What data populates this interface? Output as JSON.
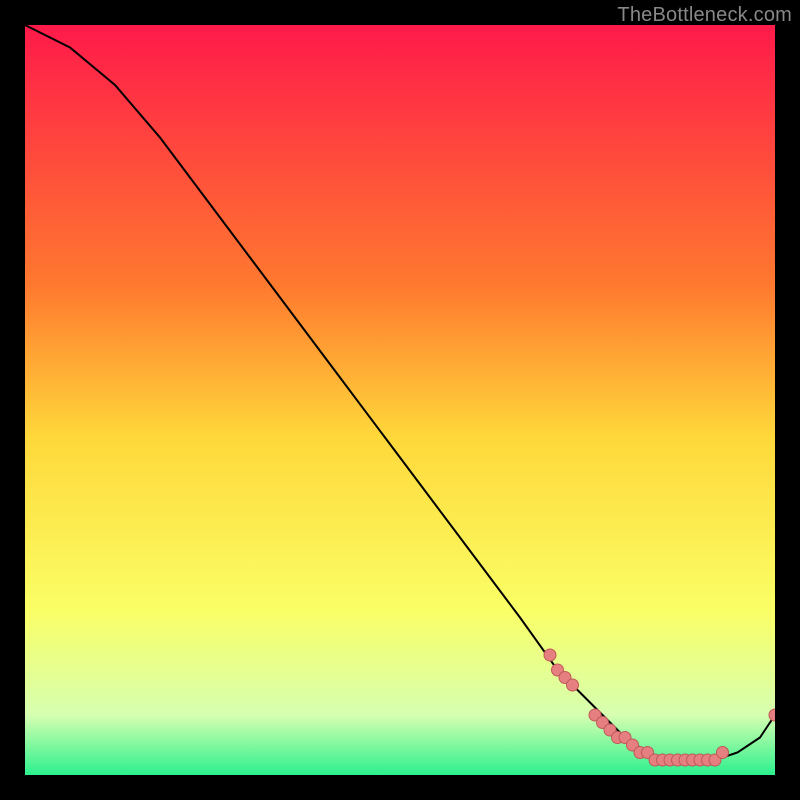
{
  "watermark": "TheBottleneck.com",
  "colors": {
    "background": "#000000",
    "gradient_top": "#ff1a4a",
    "gradient_mid_upper": "#ff7a2f",
    "gradient_mid": "#ffd83a",
    "gradient_mid_lower": "#faff66",
    "gradient_lower": "#d6ffb0",
    "gradient_bottom": "#2cf08e",
    "curve": "#000000",
    "points_fill": "#e68080",
    "points_stroke": "#c05858"
  },
  "chart_data": {
    "type": "line",
    "title": "",
    "xlabel": "",
    "ylabel": "",
    "xlim": [
      0,
      100
    ],
    "ylim": [
      0,
      100
    ],
    "legend": false,
    "grid": false,
    "series": [
      {
        "name": "bottleneck-curve",
        "x": [
          0,
          6,
          12,
          18,
          24,
          30,
          36,
          42,
          48,
          54,
          60,
          66,
          71,
          76,
          80,
          83,
          86,
          89,
          92,
          95,
          98,
          100
        ],
        "y": [
          100,
          97,
          92,
          85,
          77,
          69,
          61,
          53,
          45,
          37,
          29,
          21,
          14,
          9,
          5,
          3,
          2,
          2,
          2,
          3,
          5,
          8
        ]
      }
    ],
    "highlight_points": {
      "name": "near-minimum-points",
      "x": [
        70,
        71,
        72,
        73,
        76,
        77,
        78,
        79,
        80,
        81,
        82,
        83,
        84,
        85,
        86,
        87,
        88,
        89,
        90,
        91,
        92,
        93,
        100
      ],
      "y": [
        16,
        14,
        13,
        12,
        8,
        7,
        6,
        5,
        5,
        4,
        3,
        3,
        2,
        2,
        2,
        2,
        2,
        2,
        2,
        2,
        2,
        3,
        8
      ]
    }
  }
}
